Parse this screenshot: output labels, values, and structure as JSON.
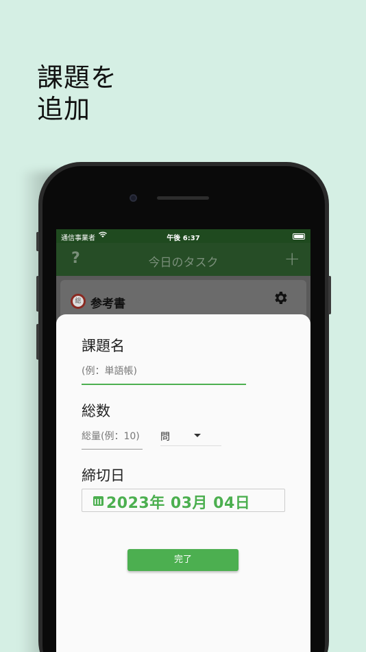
{
  "headline": {
    "line1": "課題を",
    "line2": "追加"
  },
  "status_bar": {
    "carrier": "通信事業者",
    "time": "午後 6:37"
  },
  "app_bar": {
    "help": "?",
    "title": "今日のタスク",
    "add": "+"
  },
  "card": {
    "icon_text": "総",
    "name": "参考書"
  },
  "sheet": {
    "task_name_label": "課題名",
    "task_name_placeholder": "(例：単語帳)",
    "total_label": "総数",
    "total_placeholder": "総量(例：10)",
    "unit_selected": "問",
    "deadline_label": "締切日",
    "deadline_value": "2023年 03月 04日",
    "done_button": "完了"
  },
  "colors": {
    "accent": "#4caf50",
    "app_bar": "#264d26",
    "background": "#d5efe4"
  }
}
